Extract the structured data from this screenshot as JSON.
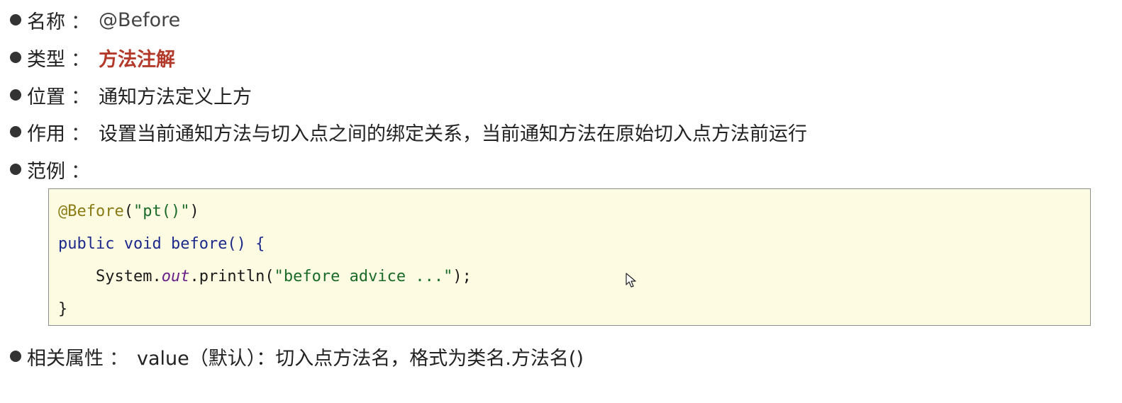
{
  "items": [
    {
      "label": "名称",
      "sep": "：",
      "value": "@Before"
    },
    {
      "label": "类型",
      "sep": "：",
      "value": "方法注解"
    },
    {
      "label": "位置",
      "sep": "：",
      "value": "通知方法定义上方"
    },
    {
      "label": "作用",
      "sep": "：",
      "value": "设置当前通知方法与切入点之间的绑定关系，当前通知方法在原始切入点方法前运行"
    },
    {
      "label": "范例",
      "sep": "："
    }
  ],
  "code": {
    "line1": {
      "annotation": "@Before",
      "open": "(",
      "string": "\"pt()\"",
      "close": ")"
    },
    "line2": {
      "kw1": "public",
      "kw2": "void",
      "rest": " before() {"
    },
    "line3": {
      "indent": "    ",
      "obj": "System.",
      "field": "out",
      "call": ".println(",
      "string": "\"before advice ...\"",
      "end": ");"
    },
    "line4": {
      "text": "}"
    }
  },
  "related": {
    "label": "相关属性",
    "sep": "：",
    "value": "value（默认）：切入点方法名，格式为类名.方法名()"
  },
  "colors": {
    "type_value": "#b33a2b",
    "code_background": "#fdfbe2",
    "annotation": "#8a7b14",
    "string": "#1a6b2a",
    "keyword": "#1c2a8c",
    "field": "#6a1f8a"
  },
  "icons": {
    "bullet": "filled-circle",
    "cursor": "mouse-pointer-icon"
  }
}
